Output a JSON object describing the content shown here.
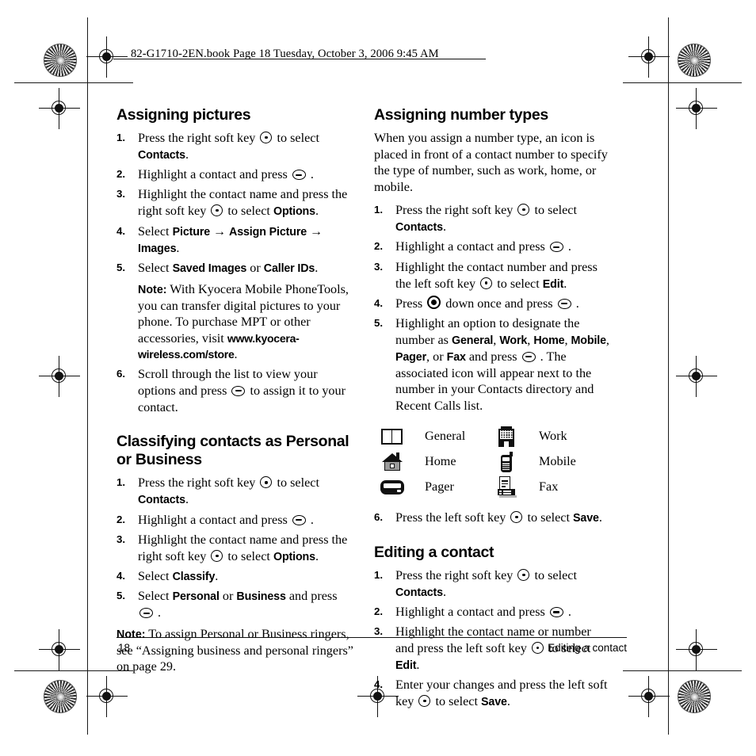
{
  "book_info": "82-G1710-2EN.book  Page 18  Tuesday, October 3, 2006  9:45 AM",
  "left_column": {
    "section1": {
      "heading": "Assigning pictures",
      "steps": [
        {
          "num": "1.",
          "parts": [
            {
              "t": "text",
              "v": "Press the right soft key "
            },
            {
              "t": "key",
              "v": "soft"
            },
            {
              "t": "text",
              "v": " to select "
            },
            {
              "t": "ui",
              "v": "Contacts"
            },
            {
              "t": "text",
              "v": "."
            }
          ]
        },
        {
          "num": "2.",
          "parts": [
            {
              "t": "text",
              "v": "Highlight a contact and press "
            },
            {
              "t": "key",
              "v": "ok"
            },
            {
              "t": "text",
              "v": " ."
            }
          ]
        },
        {
          "num": "3.",
          "parts": [
            {
              "t": "text",
              "v": "Highlight the contact name and press the right soft key "
            },
            {
              "t": "key",
              "v": "soft"
            },
            {
              "t": "text",
              "v": " to select "
            },
            {
              "t": "ui",
              "v": "Options"
            },
            {
              "t": "text",
              "v": "."
            }
          ]
        },
        {
          "num": "4.",
          "parts": [
            {
              "t": "text",
              "v": "Select "
            },
            {
              "t": "ui",
              "v": "Picture"
            },
            {
              "t": "arrow",
              "v": " → "
            },
            {
              "t": "ui",
              "v": "Assign Picture"
            },
            {
              "t": "arrow",
              "v": " → "
            },
            {
              "t": "ui",
              "v": "Images"
            },
            {
              "t": "text",
              "v": "."
            }
          ]
        },
        {
          "num": "5.",
          "parts": [
            {
              "t": "text",
              "v": "Select "
            },
            {
              "t": "ui",
              "v": "Saved Images"
            },
            {
              "t": "text",
              "v": " or "
            },
            {
              "t": "ui",
              "v": "Caller IDs"
            },
            {
              "t": "text",
              "v": "."
            }
          ]
        }
      ],
      "note": {
        "label": "Note:",
        "text": " With Kyocera Mobile PhoneTools, you can transfer digital pictures to your phone. To purchase MPT or other accessories, visit ",
        "url": "www.kyocera-wireless.com/store",
        "tail": "."
      },
      "step6": {
        "num": "6.",
        "parts": [
          {
            "t": "text",
            "v": "Scroll through the list to view your options and press "
          },
          {
            "t": "key",
            "v": "ok"
          },
          {
            "t": "text",
            "v": " to assign it to your contact."
          }
        ]
      }
    },
    "section2": {
      "heading": "Classifying contacts as Personal or Business",
      "steps": [
        {
          "num": "1.",
          "parts": [
            {
              "t": "text",
              "v": "Press the right soft key "
            },
            {
              "t": "key",
              "v": "soft"
            },
            {
              "t": "text",
              "v": " to select "
            },
            {
              "t": "ui",
              "v": "Contacts"
            },
            {
              "t": "text",
              "v": "."
            }
          ]
        },
        {
          "num": "2.",
          "parts": [
            {
              "t": "text",
              "v": "Highlight a contact and press "
            },
            {
              "t": "key",
              "v": "ok"
            },
            {
              "t": "text",
              "v": " ."
            }
          ]
        },
        {
          "num": "3.",
          "parts": [
            {
              "t": "text",
              "v": "Highlight the contact name and press the right soft key "
            },
            {
              "t": "key",
              "v": "soft"
            },
            {
              "t": "text",
              "v": " to select "
            },
            {
              "t": "ui",
              "v": "Options"
            },
            {
              "t": "text",
              "v": "."
            }
          ]
        },
        {
          "num": "4.",
          "parts": [
            {
              "t": "text",
              "v": "Select "
            },
            {
              "t": "ui",
              "v": "Classify"
            },
            {
              "t": "text",
              "v": "."
            }
          ]
        },
        {
          "num": "5.",
          "parts": [
            {
              "t": "text",
              "v": "Select "
            },
            {
              "t": "ui",
              "v": "Personal"
            },
            {
              "t": "text",
              "v": " or "
            },
            {
              "t": "ui",
              "v": "Business"
            },
            {
              "t": "text",
              "v": " and press "
            },
            {
              "t": "key",
              "v": "ok"
            },
            {
              "t": "text",
              "v": " ."
            }
          ]
        }
      ],
      "note": {
        "label": "Note:",
        "text": "  To assign Personal or Business ringers, see “Assigning business and personal ringers” on page 29."
      }
    }
  },
  "right_column": {
    "section1": {
      "heading": "Assigning number types",
      "intro": "When you assign a number type, an icon is placed in front of a contact number to specify the type of number, such as work, home, or mobile.",
      "steps": [
        {
          "num": "1.",
          "parts": [
            {
              "t": "text",
              "v": "Press the right soft key "
            },
            {
              "t": "key",
              "v": "soft"
            },
            {
              "t": "text",
              "v": " to select "
            },
            {
              "t": "ui",
              "v": "Contacts"
            },
            {
              "t": "text",
              "v": "."
            }
          ]
        },
        {
          "num": "2.",
          "parts": [
            {
              "t": "text",
              "v": "Highlight a contact and press "
            },
            {
              "t": "key",
              "v": "ok"
            },
            {
              "t": "text",
              "v": " ."
            }
          ]
        },
        {
          "num": "3.",
          "parts": [
            {
              "t": "text",
              "v": "Highlight the contact number and press the left soft key "
            },
            {
              "t": "key",
              "v": "soft"
            },
            {
              "t": "text",
              "v": " to select "
            },
            {
              "t": "ui",
              "v": "Edit"
            },
            {
              "t": "text",
              "v": "."
            }
          ]
        },
        {
          "num": "4.",
          "parts": [
            {
              "t": "text",
              "v": "Press "
            },
            {
              "t": "key",
              "v": "nav"
            },
            {
              "t": "text",
              "v": " down once and press "
            },
            {
              "t": "key",
              "v": "ok"
            },
            {
              "t": "text",
              "v": " ."
            }
          ]
        },
        {
          "num": "5.",
          "parts": [
            {
              "t": "text",
              "v": "Highlight an option to designate the number as "
            },
            {
              "t": "ui",
              "v": "General"
            },
            {
              "t": "text",
              "v": ", "
            },
            {
              "t": "ui",
              "v": "Work"
            },
            {
              "t": "text",
              "v": ", "
            },
            {
              "t": "ui",
              "v": "Home"
            },
            {
              "t": "text",
              "v": ", "
            },
            {
              "t": "ui",
              "v": "Mobile"
            },
            {
              "t": "text",
              "v": ", "
            },
            {
              "t": "ui",
              "v": "Pager"
            },
            {
              "t": "text",
              "v": ", or "
            },
            {
              "t": "ui",
              "v": "Fax"
            },
            {
              "t": "text",
              "v": " and press "
            },
            {
              "t": "key",
              "v": "ok"
            },
            {
              "t": "text",
              "v": " . The associated icon will appear next to the number in your Contacts directory and Recent Calls list."
            }
          ]
        }
      ],
      "legend": [
        {
          "icon": "book-icon",
          "label": "General",
          "col": 0,
          "row": 0
        },
        {
          "icon": "building-icon",
          "label": "Work",
          "col": 1,
          "row": 0
        },
        {
          "icon": "house-icon",
          "label": "Home",
          "col": 0,
          "row": 1
        },
        {
          "icon": "cellphone-icon",
          "label": "Mobile",
          "col": 1,
          "row": 1
        },
        {
          "icon": "pager-icon",
          "label": "Pager",
          "col": 0,
          "row": 2
        },
        {
          "icon": "fax-icon",
          "label": "Fax",
          "col": 1,
          "row": 2
        }
      ],
      "step6": {
        "num": "6.",
        "parts": [
          {
            "t": "text",
            "v": "Press the left soft key "
          },
          {
            "t": "key",
            "v": "soft"
          },
          {
            "t": "text",
            "v": " to select "
          },
          {
            "t": "ui",
            "v": "Save"
          },
          {
            "t": "text",
            "v": "."
          }
        ]
      }
    },
    "section2": {
      "heading": "Editing a contact",
      "steps": [
        {
          "num": "1.",
          "parts": [
            {
              "t": "text",
              "v": "Press the right soft key "
            },
            {
              "t": "key",
              "v": "soft"
            },
            {
              "t": "text",
              "v": " to select "
            },
            {
              "t": "ui",
              "v": "Contacts"
            },
            {
              "t": "text",
              "v": "."
            }
          ]
        },
        {
          "num": "2.",
          "parts": [
            {
              "t": "text",
              "v": "Highlight a contact and press "
            },
            {
              "t": "key",
              "v": "ok"
            },
            {
              "t": "text",
              "v": " ."
            }
          ]
        },
        {
          "num": "3.",
          "parts": [
            {
              "t": "text",
              "v": "Highlight the contact name or number and press the left soft key "
            },
            {
              "t": "key",
              "v": "soft"
            },
            {
              "t": "text",
              "v": " to select "
            },
            {
              "t": "ui",
              "v": "Edit"
            },
            {
              "t": "text",
              "v": "."
            }
          ]
        },
        {
          "num": "4.",
          "parts": [
            {
              "t": "text",
              "v": "Enter your changes and press the left soft key "
            },
            {
              "t": "key",
              "v": "soft"
            },
            {
              "t": "text",
              "v": " to select "
            },
            {
              "t": "ui",
              "v": "Save"
            },
            {
              "t": "text",
              "v": "."
            }
          ]
        }
      ]
    }
  },
  "footer": {
    "page_number": "18",
    "section_title": "Editing a contact"
  }
}
